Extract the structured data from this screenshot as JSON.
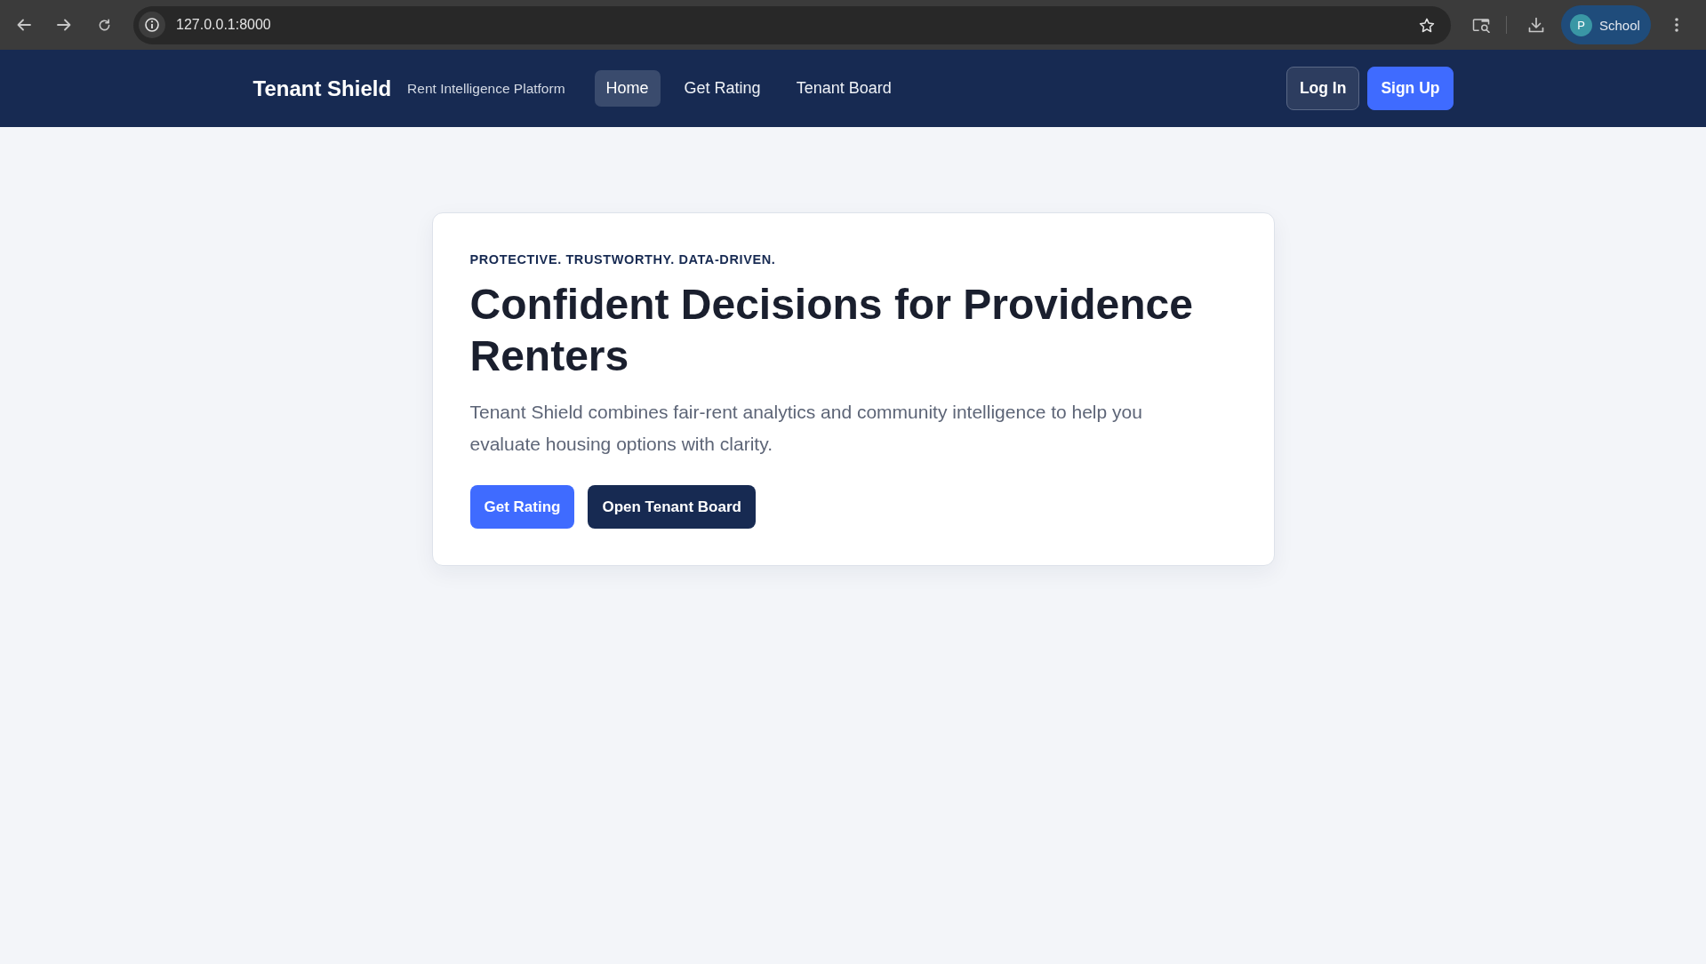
{
  "browser": {
    "url": "127.0.0.1:8000",
    "profile": {
      "initial": "P",
      "name": "School"
    }
  },
  "navbar": {
    "brand": "Tenant Shield",
    "tagline": "Rent Intelligence Platform",
    "links": [
      {
        "label": "Home",
        "selected": true
      },
      {
        "label": "Get Rating",
        "selected": false
      },
      {
        "label": "Tenant Board",
        "selected": false
      }
    ],
    "actions": [
      {
        "label": "Log In",
        "kind": "outline"
      },
      {
        "label": "Sign Up",
        "kind": "primary"
      }
    ]
  },
  "hero": {
    "eyebrow": "PROTECTIVE. TRUSTWORTHY. DATA-DRIVEN.",
    "title": "Confident Decisions for Providence Renters",
    "text": "Tenant Shield combines fair-rent analytics and community intelligence to help you evaluate housing options with clarity.",
    "buttons": [
      {
        "label": "Get Rating",
        "kind": "primary"
      },
      {
        "label": "Open Tenant Board",
        "kind": "dark"
      }
    ]
  }
}
